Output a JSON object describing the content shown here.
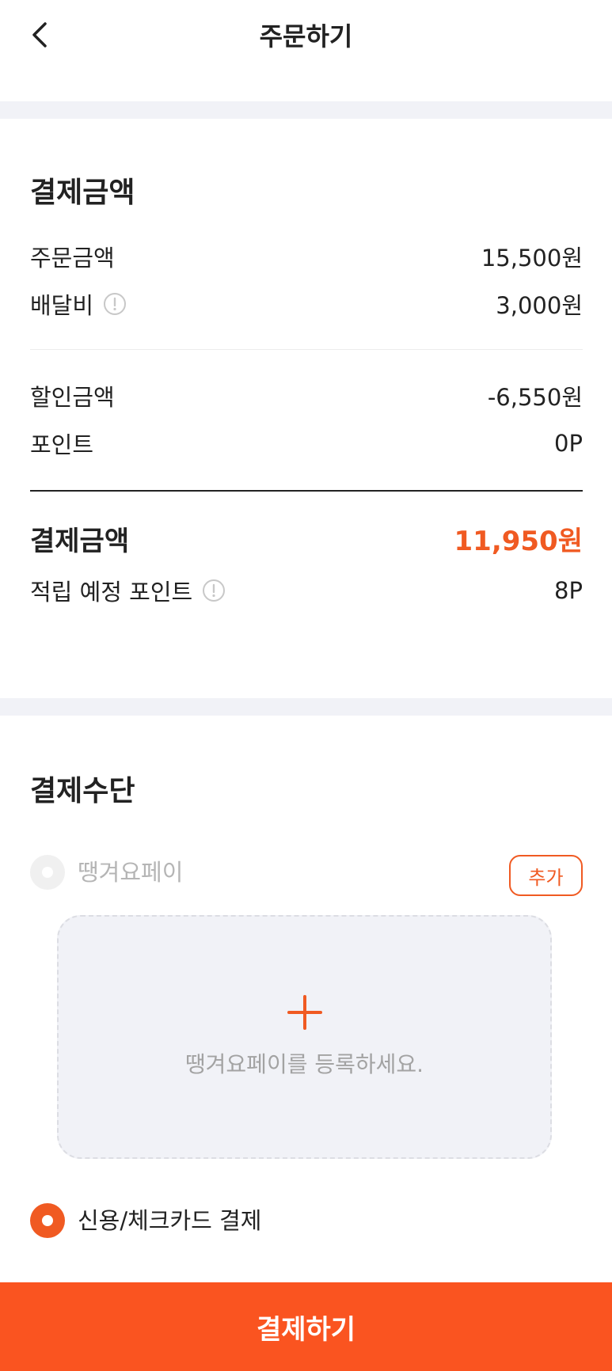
{
  "header": {
    "title": "주문하기",
    "back_icon": "chevron-left-icon"
  },
  "summary": {
    "title": "결제금액",
    "order_amount_label": "주문금액",
    "order_amount_value": "15,500원",
    "delivery_fee_label": "배달비",
    "delivery_fee_value": "3,000원",
    "discount_label": "할인금액",
    "discount_value": "-6,550원",
    "point_label": "포인트",
    "point_value": "0P",
    "total_label": "결제금액",
    "total_value": "11,950원",
    "earn_label": "적립 예정 포인트",
    "earn_value": "8P",
    "info_icon": "info-circle-icon"
  },
  "payment": {
    "title": "결제수단",
    "option_pay_label": "땡겨요페이",
    "add_label": "추가",
    "register_text": "땡겨요페이를 등록하세요.",
    "option_card_label": "신용/체크카드 결제",
    "selected": "card"
  },
  "footer": {
    "pay_button_label": "결제하기"
  },
  "colors": {
    "accent": "#f05a22",
    "button": "#fa5420",
    "band": "#f1f2f7"
  }
}
